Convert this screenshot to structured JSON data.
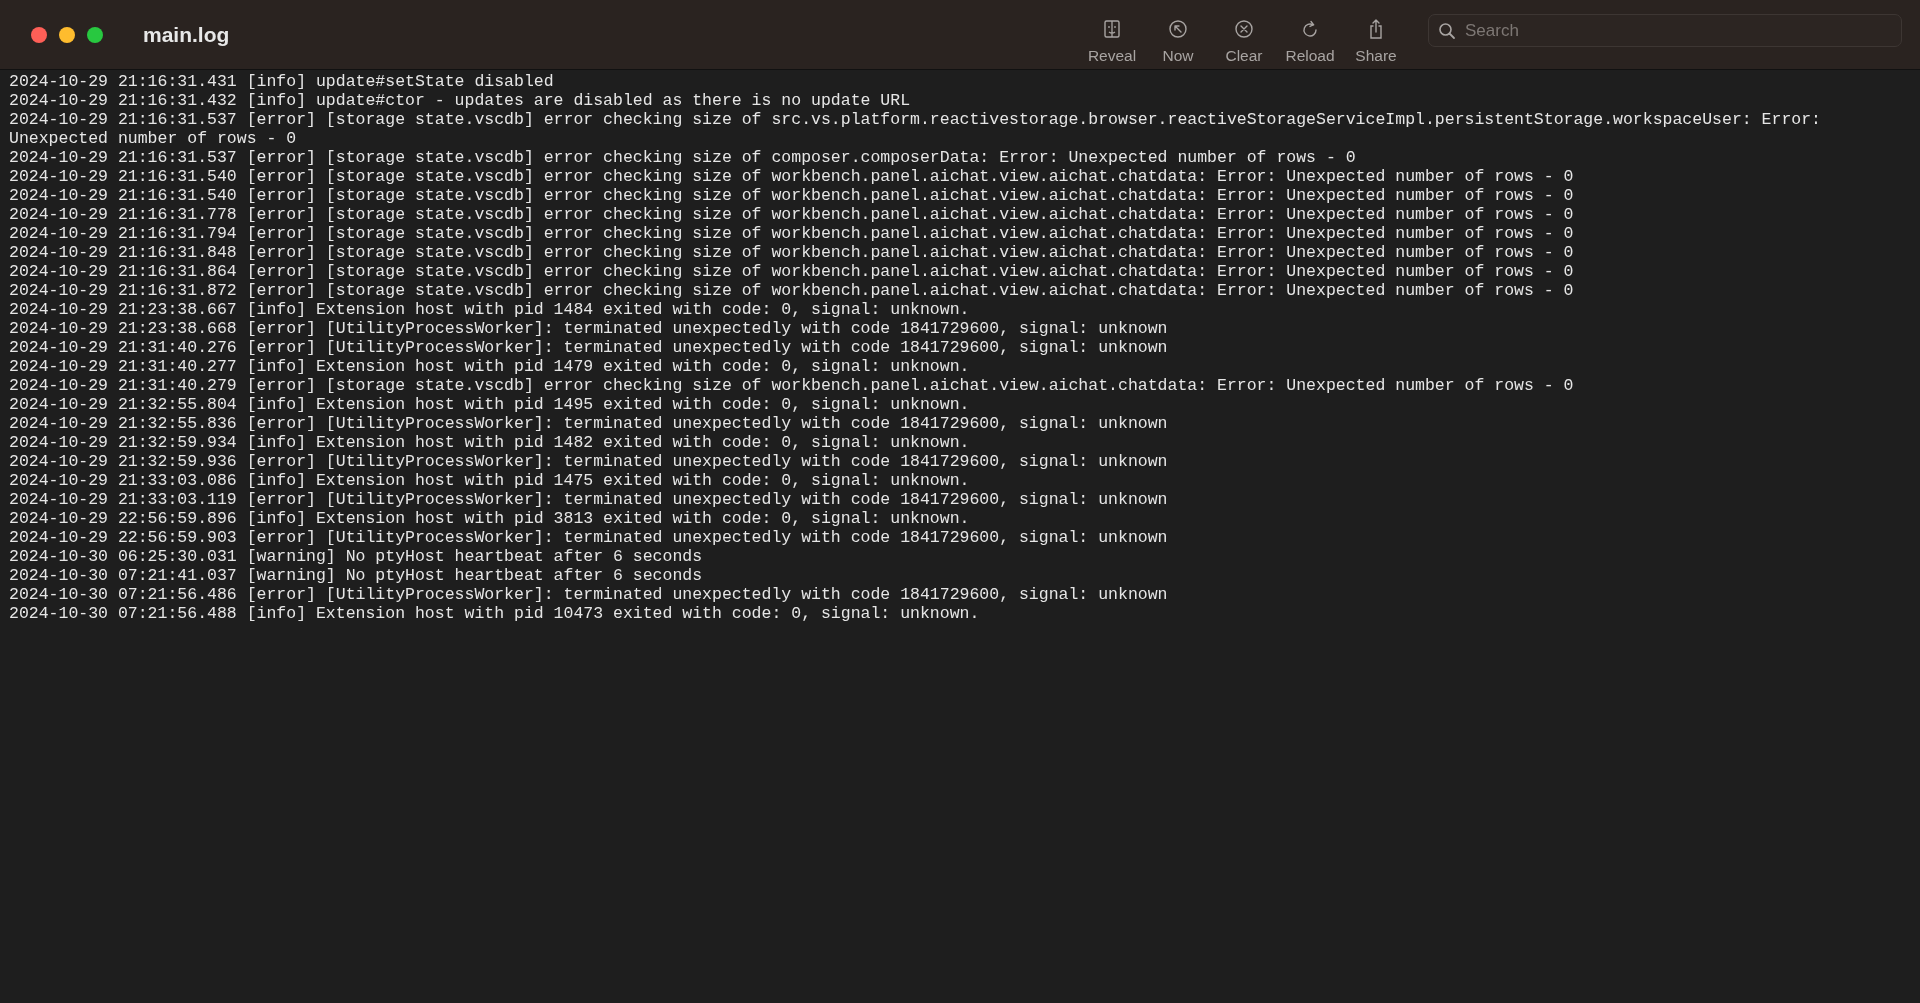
{
  "window": {
    "title": "main.log"
  },
  "toolbar": [
    {
      "kind": "reveal",
      "label": "Reveal"
    },
    {
      "kind": "now",
      "label": "Now"
    },
    {
      "kind": "clear",
      "label": "Clear"
    },
    {
      "kind": "reload",
      "label": "Reload"
    },
    {
      "kind": "share",
      "label": "Share"
    }
  ],
  "search": {
    "placeholder": "Search"
  },
  "log_lines": [
    "2024-10-29 21:16:31.431 [info] update#setState disabled",
    "2024-10-29 21:16:31.432 [info] update#ctor - updates are disabled as there is no update URL",
    "2024-10-29 21:16:31.537 [error] [storage state.vscdb] error checking size of src.vs.platform.reactivestorage.browser.reactiveStorageServiceImpl.persistentStorage.workspaceUser: Error: Unexpected number of rows - 0",
    "2024-10-29 21:16:31.537 [error] [storage state.vscdb] error checking size of composer.composerData: Error: Unexpected number of rows - 0",
    "2024-10-29 21:16:31.540 [error] [storage state.vscdb] error checking size of workbench.panel.aichat.view.aichat.chatdata: Error: Unexpected number of rows - 0",
    "2024-10-29 21:16:31.540 [error] [storage state.vscdb] error checking size of workbench.panel.aichat.view.aichat.chatdata: Error: Unexpected number of rows - 0",
    "2024-10-29 21:16:31.778 [error] [storage state.vscdb] error checking size of workbench.panel.aichat.view.aichat.chatdata: Error: Unexpected number of rows - 0",
    "2024-10-29 21:16:31.794 [error] [storage state.vscdb] error checking size of workbench.panel.aichat.view.aichat.chatdata: Error: Unexpected number of rows - 0",
    "2024-10-29 21:16:31.848 [error] [storage state.vscdb] error checking size of workbench.panel.aichat.view.aichat.chatdata: Error: Unexpected number of rows - 0",
    "2024-10-29 21:16:31.864 [error] [storage state.vscdb] error checking size of workbench.panel.aichat.view.aichat.chatdata: Error: Unexpected number of rows - 0",
    "2024-10-29 21:16:31.872 [error] [storage state.vscdb] error checking size of workbench.panel.aichat.view.aichat.chatdata: Error: Unexpected number of rows - 0",
    "2024-10-29 21:23:38.667 [info] Extension host with pid 1484 exited with code: 0, signal: unknown.",
    "2024-10-29 21:23:38.668 [error] [UtilityProcessWorker]: terminated unexpectedly with code 1841729600, signal: unknown",
    "2024-10-29 21:31:40.276 [error] [UtilityProcessWorker]: terminated unexpectedly with code 1841729600, signal: unknown",
    "2024-10-29 21:31:40.277 [info] Extension host with pid 1479 exited with code: 0, signal: unknown.",
    "2024-10-29 21:31:40.279 [error] [storage state.vscdb] error checking size of workbench.panel.aichat.view.aichat.chatdata: Error: Unexpected number of rows - 0",
    "2024-10-29 21:32:55.804 [info] Extension host with pid 1495 exited with code: 0, signal: unknown.",
    "2024-10-29 21:32:55.836 [error] [UtilityProcessWorker]: terminated unexpectedly with code 1841729600, signal: unknown",
    "2024-10-29 21:32:59.934 [info] Extension host with pid 1482 exited with code: 0, signal: unknown.",
    "2024-10-29 21:32:59.936 [error] [UtilityProcessWorker]: terminated unexpectedly with code 1841729600, signal: unknown",
    "2024-10-29 21:33:03.086 [info] Extension host with pid 1475 exited with code: 0, signal: unknown.",
    "2024-10-29 21:33:03.119 [error] [UtilityProcessWorker]: terminated unexpectedly with code 1841729600, signal: unknown",
    "2024-10-29 22:56:59.896 [info] Extension host with pid 3813 exited with code: 0, signal: unknown.",
    "2024-10-29 22:56:59.903 [error] [UtilityProcessWorker]: terminated unexpectedly with code 1841729600, signal: unknown",
    "2024-10-30 06:25:30.031 [warning] No ptyHost heartbeat after 6 seconds",
    "2024-10-30 07:21:41.037 [warning] No ptyHost heartbeat after 6 seconds",
    "2024-10-30 07:21:56.486 [error] [UtilityProcessWorker]: terminated unexpectedly with code 1841729600, signal: unknown",
    "2024-10-30 07:21:56.488 [info] Extension host with pid 10473 exited with code: 0, signal: unknown."
  ]
}
